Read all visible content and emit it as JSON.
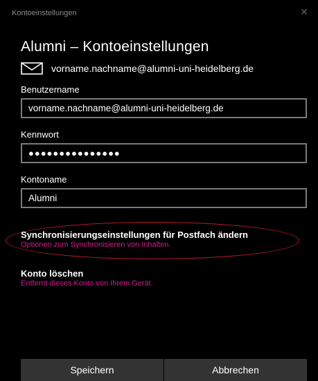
{
  "window": {
    "title": "Kontoeinstellungen",
    "close_icon": "close-icon"
  },
  "heading": "Alumni – Kontoeinstellungen",
  "email": {
    "icon": "mail-icon",
    "address": "vorname.nachname@alumni-uni-heidelberg.de"
  },
  "fields": {
    "username": {
      "label": "Benutzername",
      "value": "vorname.nachname@alumni-uni-heidelberg.de"
    },
    "password": {
      "label": "Kennwort",
      "value": "●●●●●●●●●●●●●●●"
    },
    "account_name": {
      "label": "Kontoname",
      "value": "Alumni"
    }
  },
  "sync": {
    "title": "Synchronisierungseinstellungen für Postfach ändern",
    "subtitle": "Optionen zum Synchronisieren von Inhalten."
  },
  "delete": {
    "title": "Konto löschen",
    "subtitle": "Entfernt dieses Konto von Ihrem Gerät."
  },
  "buttons": {
    "save": "Speichern",
    "cancel": "Abbrechen"
  },
  "colors": {
    "background": "#000000",
    "accent": "#d01c8b",
    "highlight_ellipse": "#b71c2b",
    "button_bg": "#333333",
    "field_border": "#7b7b7b"
  }
}
